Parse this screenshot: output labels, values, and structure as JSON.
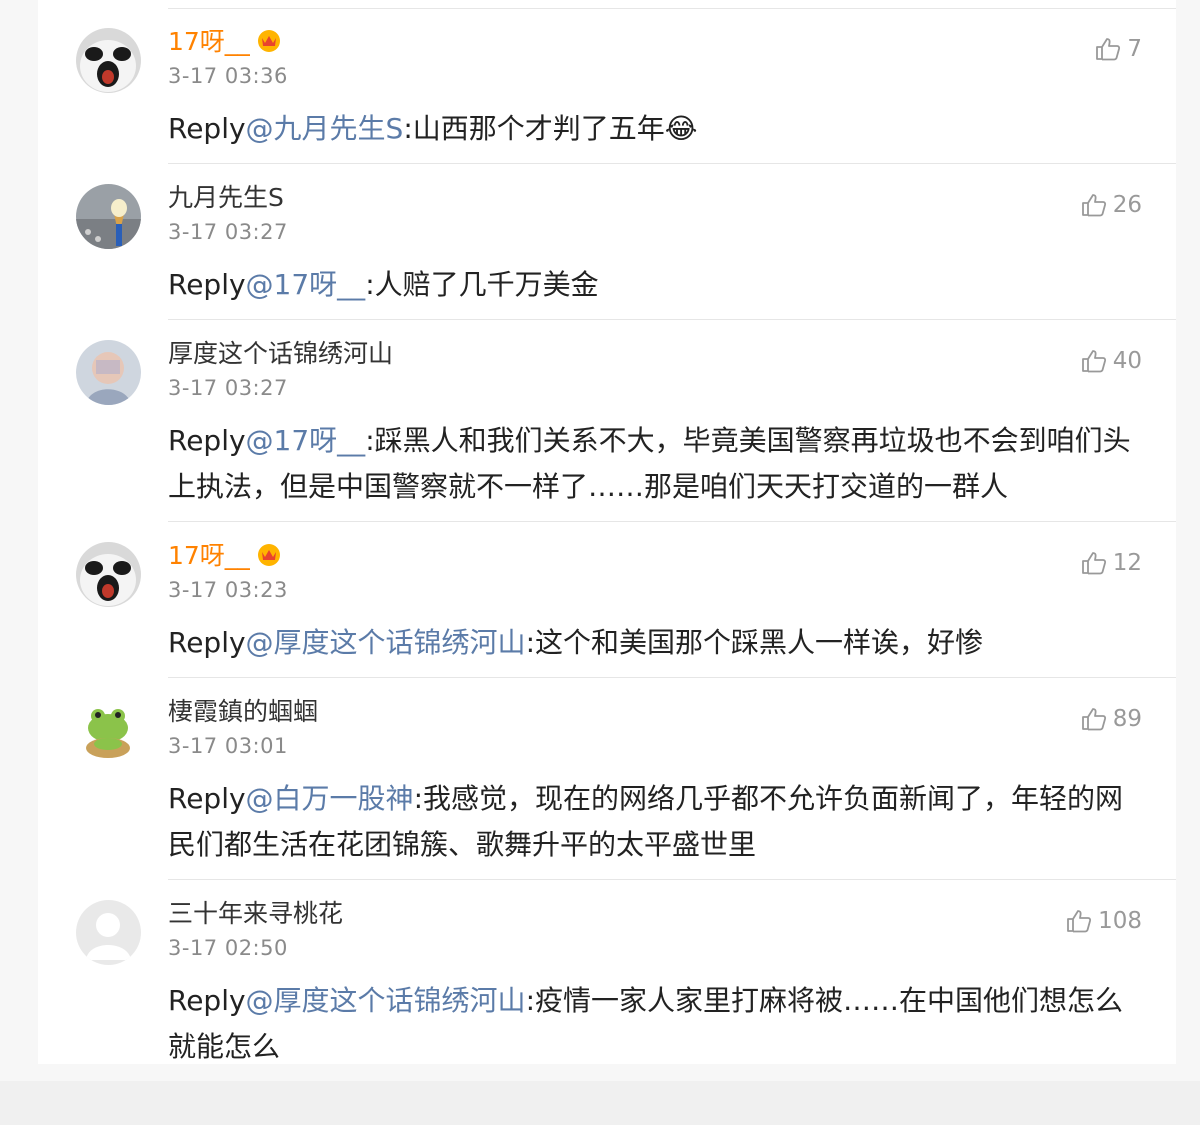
{
  "comments": [
    {
      "username": "17呀__",
      "vip": true,
      "time": "3-17 03:36",
      "likes": "7",
      "reply_prefix": "Reply",
      "mention": "@九月先生S",
      "text": ":山西那个才判了五年",
      "emoji": "😂",
      "avatar": "panda-dog-icon"
    },
    {
      "username": "九月先生S",
      "vip": false,
      "time": "3-17 03:27",
      "likes": "26",
      "reply_prefix": "Reply",
      "mention": "@17呀__",
      "text": ":人赔了几千万美金",
      "avatar": "ice-cream-photo-icon"
    },
    {
      "username": "厚度这个话锦绣河山",
      "vip": false,
      "time": "3-17 03:27",
      "likes": "40",
      "reply_prefix": "Reply",
      "mention": "@17呀__",
      "text": ":踩黑人和我们关系不大，毕竟美国警察再垃圾也不会到咱们头上执法，但是中国警察就不一样了……那是咱们天天打交道的一群人",
      "avatar": "portrait-photo-icon"
    },
    {
      "username": "17呀__",
      "vip": true,
      "time": "3-17 03:23",
      "likes": "12",
      "reply_prefix": "Reply",
      "mention": "@厚度这个话锦绣河山",
      "text": ":这个和美国那个踩黑人一样诶，好惨",
      "avatar": "panda-dog-icon"
    },
    {
      "username": "棲霞鎮的蝈蝈",
      "vip": false,
      "time": "3-17 03:01",
      "likes": "89",
      "reply_prefix": "Reply",
      "mention": "@白万一股神",
      "text": ":我感觉，现在的网络几乎都不允许负面新闻了，年轻的网民们都生活在花团锦簇、歌舞升平的太平盛世里",
      "avatar": "frog-cartoon-icon"
    },
    {
      "username": "三十年来寻桃花",
      "vip": false,
      "time": "3-17 02:50",
      "likes": "108",
      "reply_prefix": "Reply",
      "mention": "@厚度这个话锦绣河山",
      "text": ":疫情一家人家里打麻将被……在中国他们想怎么就能怎么",
      "avatar": "default-avatar-icon"
    }
  ],
  "colors": {
    "vip_name": "#ff8200",
    "mention": "#5b7ba8",
    "meta": "#8a8a8a"
  }
}
